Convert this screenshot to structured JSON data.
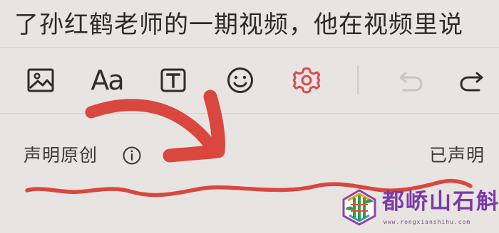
{
  "editor": {
    "content_line": "了孙红鹤老师的一期视频，他在视频里说"
  },
  "toolbar": {
    "image_icon": "image-icon",
    "font_label": "Aa",
    "text_icon": "text-box-icon",
    "emoji_icon": "smile-icon",
    "settings_icon": "gear-icon",
    "undo_icon": "undo-icon",
    "redo_icon": "redo-icon",
    "settings_color": "#d34e4d",
    "disabled_color": "#c8c5c4"
  },
  "declaration": {
    "label": "声明原创",
    "info_icon": "info-icon",
    "status": "已声明"
  },
  "annotation": {
    "color": "#d9473e"
  },
  "watermark": {
    "brand": "都峤山石斛",
    "url": "www.rongxianshihu.com"
  }
}
